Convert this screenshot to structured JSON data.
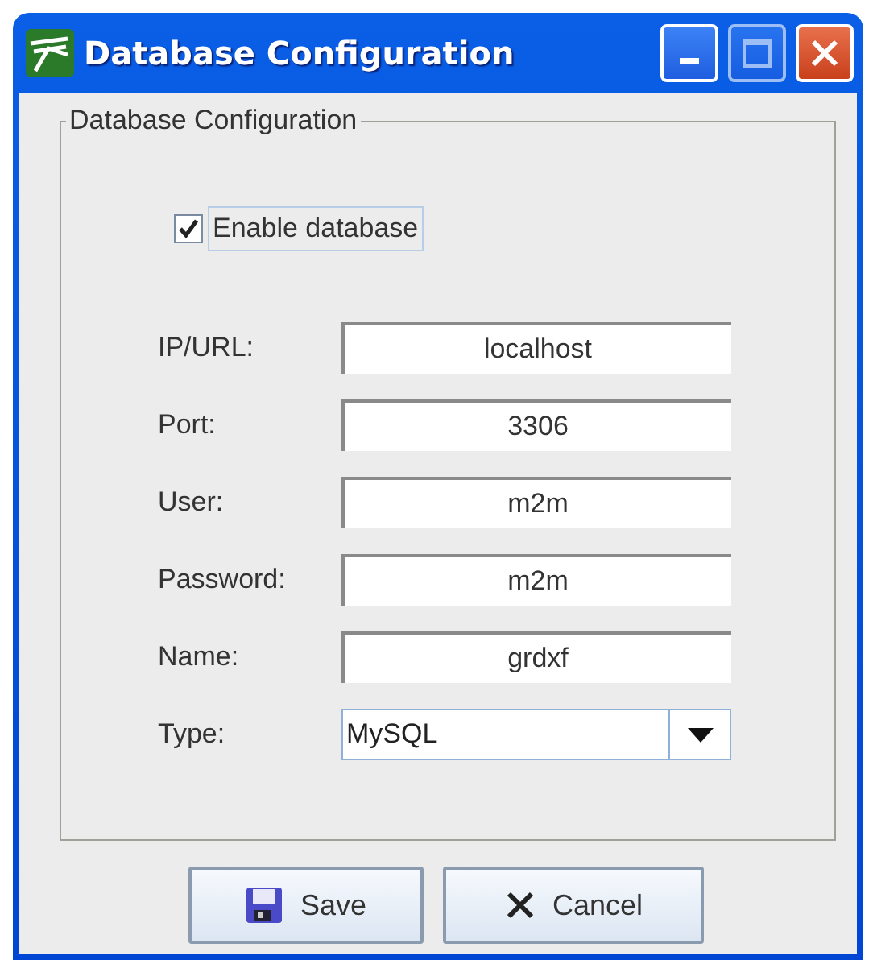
{
  "window": {
    "title": "Database Configuration"
  },
  "group": {
    "title": "Database Configuration"
  },
  "enable": {
    "label": "Enable database",
    "checked": true
  },
  "fields": [
    {
      "label": "IP/URL:",
      "value": "localhost"
    },
    {
      "label": "Port:",
      "value": "3306"
    },
    {
      "label": "User:",
      "value": "m2m"
    },
    {
      "label": "Password:",
      "value": "m2m"
    },
    {
      "label": "Name:",
      "value": "grdxf"
    }
  ],
  "type": {
    "label": "Type:",
    "value": "MySQL"
  },
  "buttons": [
    {
      "kind": "save",
      "label": "Save"
    },
    {
      "kind": "cancel",
      "label": "Cancel"
    }
  ]
}
